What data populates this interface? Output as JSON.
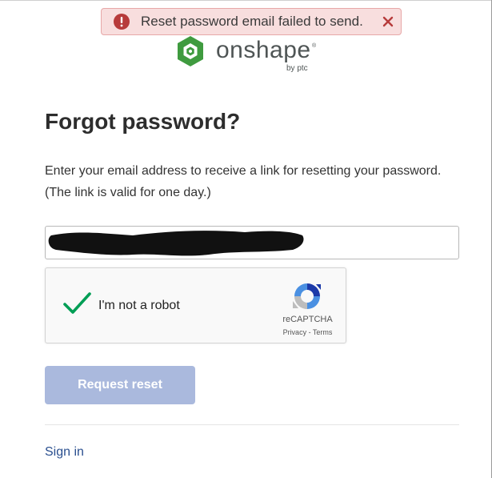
{
  "toast": {
    "icon": "error-icon",
    "message": "Reset password email failed to send.",
    "close_icon": "close-icon",
    "colors": {
      "background": "#f8dede",
      "border": "#e7a8a8",
      "icon": "#b73b3b",
      "close": "#b73b3b"
    }
  },
  "brand": {
    "name": "onshape",
    "registered": "®",
    "tagline": "by ptc",
    "logo_icon": "onshape-logo-icon",
    "colors": {
      "logo_green": "#3f9b3f",
      "wordmark": "#4f5555"
    }
  },
  "page": {
    "title": "Forgot password?",
    "description": "Enter your email address to receive a link for resetting your password. (The link is valid for one day.)"
  },
  "email_field": {
    "value": "",
    "redacted": true
  },
  "recaptcha": {
    "checked": true,
    "label": "I'm not a robot",
    "brand": "reCAPTCHA",
    "privacy_link": "Privacy",
    "separator": " - ",
    "terms_link": "Terms",
    "check_icon": "checkmark-icon",
    "logo_icon": "recaptcha-logo-icon",
    "colors": {
      "check": "#009e55"
    }
  },
  "actions": {
    "request_reset_label": "Request reset",
    "request_reset_disabled": true,
    "colors": {
      "button_disabled": "#aab9dd"
    }
  },
  "footer": {
    "sign_in_label": "Sign in",
    "colors": {
      "link": "#2a4f8f"
    }
  }
}
